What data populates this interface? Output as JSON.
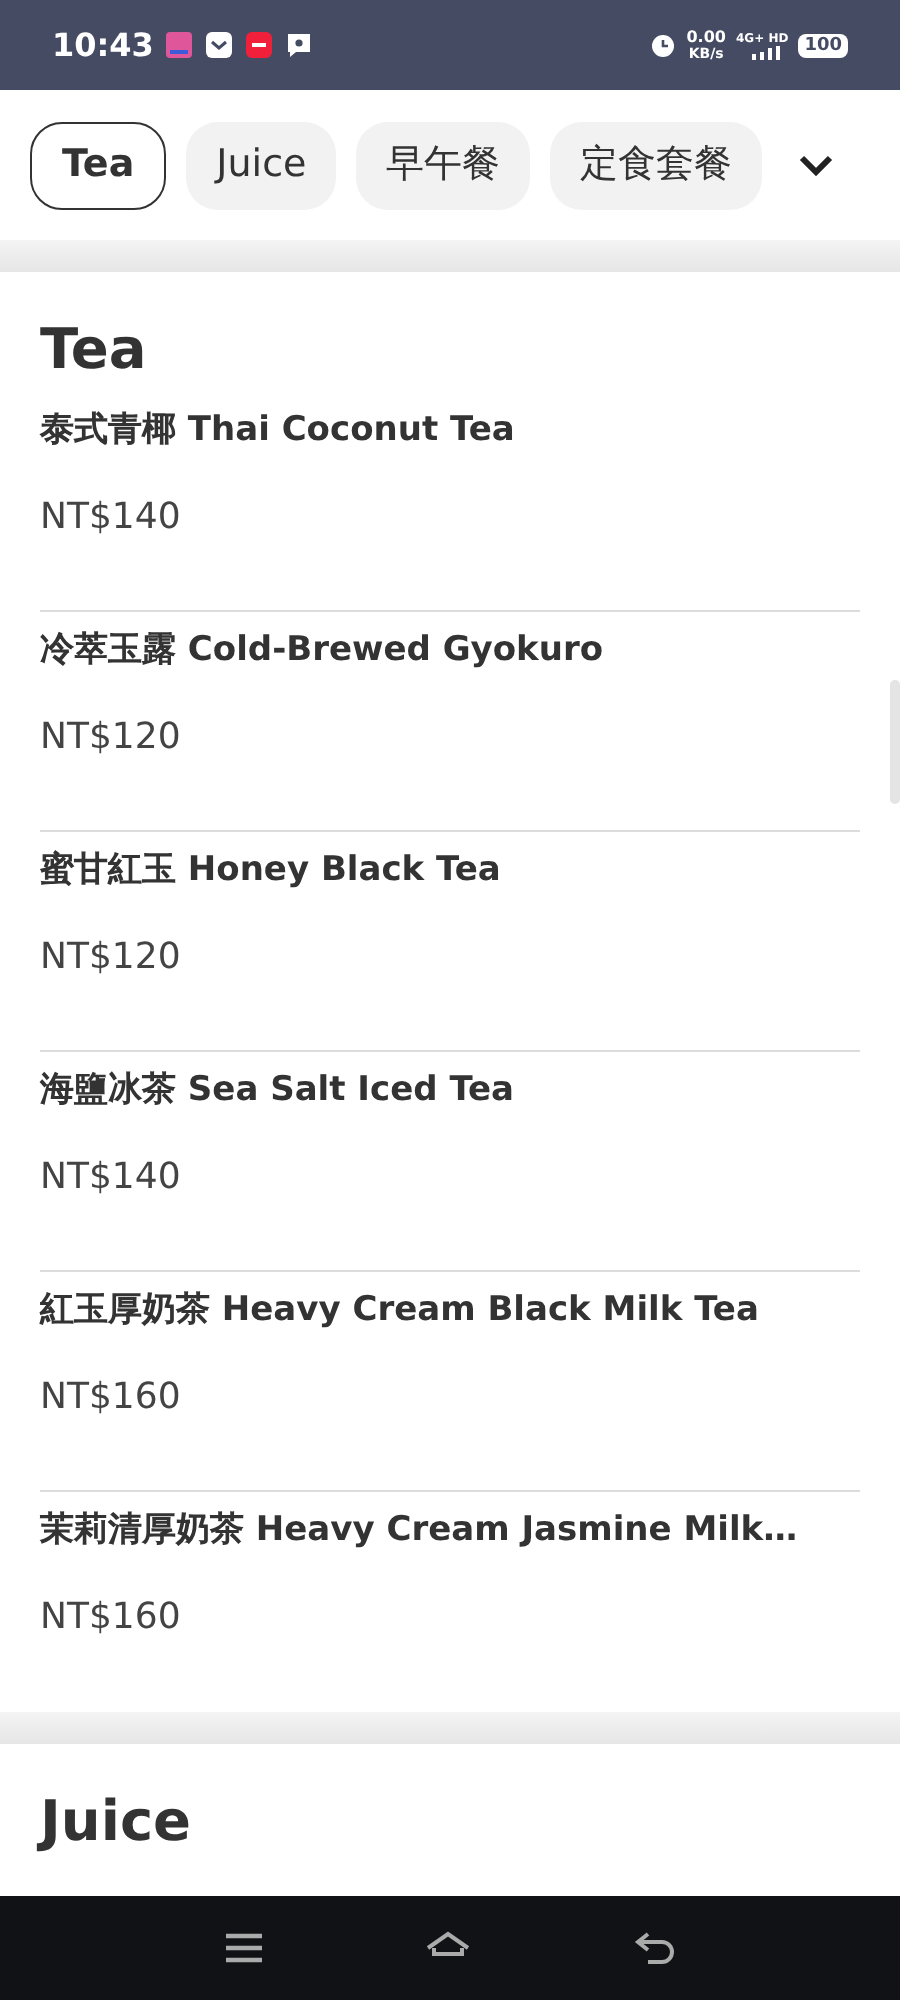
{
  "status_bar": {
    "time": "10:43",
    "speed_value": "0.00",
    "speed_unit": "KB/s",
    "network": "4G+ HD",
    "battery": "100"
  },
  "category_tabs": [
    {
      "label": "Tea",
      "selected": true
    },
    {
      "label": "Juice",
      "selected": false
    },
    {
      "label": "早午餐",
      "selected": false
    },
    {
      "label": "定食套餐",
      "selected": false
    }
  ],
  "sections": [
    {
      "title": "Tea",
      "items": [
        {
          "name": "泰式青椰 Thai Coconut Tea",
          "price": "NT$140"
        },
        {
          "name": "冷萃玉露 Cold-Brewed Gyokuro",
          "price": "NT$120"
        },
        {
          "name": "蜜甘紅玉 Honey Black Tea",
          "price": "NT$120"
        },
        {
          "name": "海鹽冰茶 Sea Salt Iced Tea",
          "price": "NT$140"
        },
        {
          "name": "紅玉厚奶茶 Heavy Cream Black Milk Tea",
          "price": "NT$160"
        },
        {
          "name": "茉莉清厚奶茶 Heavy Cream Jasmine Milk…",
          "price": "NT$160"
        }
      ]
    },
    {
      "title": "Juice"
    }
  ]
}
